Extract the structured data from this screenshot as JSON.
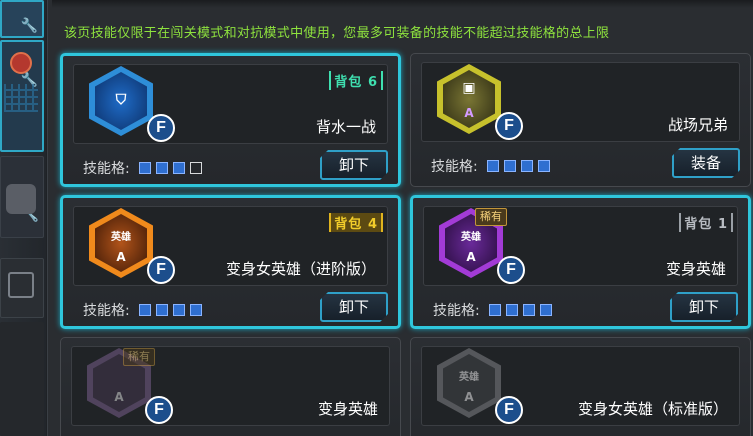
{
  "notice": "该页技能仅限于在闯关模式和对抗模式中使用，您最多可装备的技能不能超过技能格的总上限",
  "slots_label": "技能格:",
  "cards": [
    {
      "name": "背水一战",
      "bag": "背包 6",
      "action": "卸下",
      "slots_filled": 3,
      "slots_total": 4,
      "badge": "F",
      "hex_label": "",
      "hex_grade": "",
      "rare": "",
      "selected": true
    },
    {
      "name": "战场兄弟",
      "bag": "",
      "action": "装备",
      "slots_filled": 4,
      "slots_total": 4,
      "badge": "F",
      "hex_label": "",
      "hex_grade": "A",
      "rare": "",
      "selected": false
    },
    {
      "name": "变身女英雄（进阶版）",
      "bag": "背包 4",
      "action": "卸下",
      "slots_filled": 4,
      "slots_total": 4,
      "badge": "F",
      "hex_label": "英雄",
      "hex_grade": "A",
      "rare": "",
      "selected": true
    },
    {
      "name": "变身英雄",
      "bag": "背包 1",
      "action": "卸下",
      "slots_filled": 4,
      "slots_total": 4,
      "badge": "F",
      "hex_label": "英雄",
      "hex_grade": "A",
      "rare": "稀有",
      "selected": true
    },
    {
      "name": "变身英雄",
      "bag": "",
      "action": "",
      "slots_filled": 0,
      "slots_total": 0,
      "badge": "F",
      "hex_label": "",
      "hex_grade": "A",
      "rare": "稀有",
      "selected": false
    },
    {
      "name": "变身女英雄（标准版）",
      "bag": "",
      "action": "",
      "slots_filled": 0,
      "slots_total": 0,
      "badge": "F",
      "hex_label": "英雄",
      "hex_grade": "A",
      "rare": "",
      "selected": false
    }
  ]
}
